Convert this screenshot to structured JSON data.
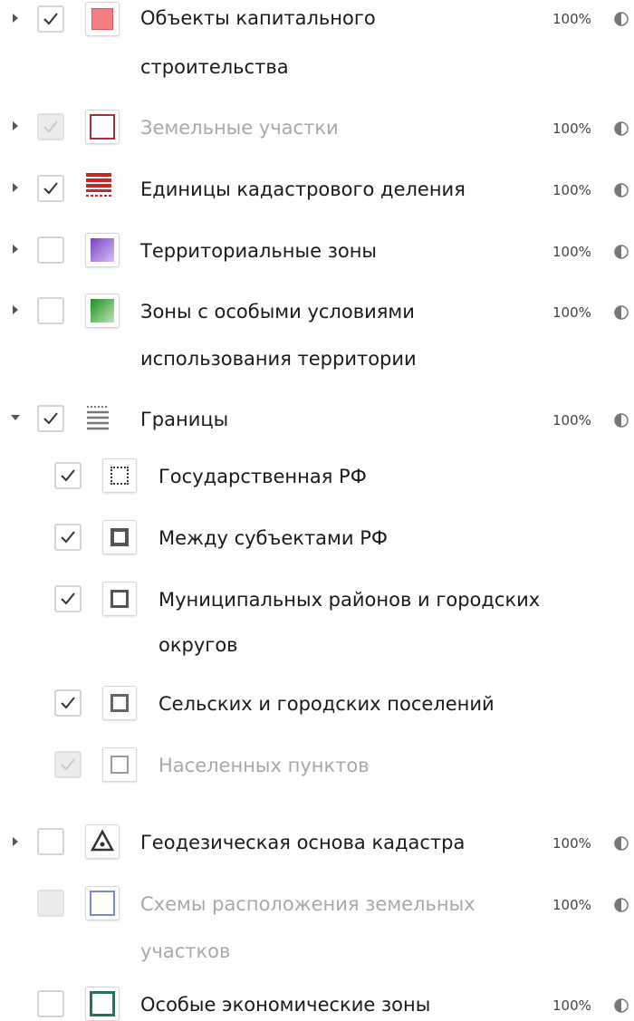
{
  "layers": [
    {
      "label_line1": "Объекты капитального",
      "label_line2": "строительства",
      "opacity": "100%"
    },
    {
      "label_line1": "Земельные участки",
      "opacity": "100%"
    },
    {
      "label_line1": "Единицы кадастрового деления",
      "opacity": "100%"
    },
    {
      "label_line1": "Территориальные зоны",
      "opacity": "100%"
    },
    {
      "label_line1": "Зоны с особыми условиями",
      "label_line2": "использования территории",
      "opacity": "100%"
    },
    {
      "label_line1": "Границы",
      "opacity": "100%"
    },
    {
      "label_line1": "Государственная РФ"
    },
    {
      "label_line1": "Между субъектами РФ"
    },
    {
      "label_line1": "Муниципальных районов и городских",
      "label_line2": "округов"
    },
    {
      "label_line1": "Сельских и городских поселений"
    },
    {
      "label_line1": "Населенных пунктов"
    },
    {
      "label_line1": "Геодезическая основа кадастра",
      "opacity": "100%"
    },
    {
      "label_line1": "Схемы расположения земельных",
      "label_line2": "участков",
      "opacity": "100%"
    },
    {
      "label_line1": "Особые экономические зоны",
      "opacity": "100%"
    }
  ],
  "icons": {
    "expand": "caret-right-icon",
    "collapse": "caret-down-icon",
    "check": "checkmark-icon",
    "opacity": "half-circle-opacity-icon"
  },
  "colors": {
    "capital_objects": "#f47e80",
    "land_plots_border": "#a3303a",
    "cadastral_units": "#c62828",
    "territorial_zones": "#8f59d8",
    "special_zones": "#3da83f",
    "land_schemes_border": "#7b86d0",
    "economic_zones_border": "#2e6e5e"
  }
}
